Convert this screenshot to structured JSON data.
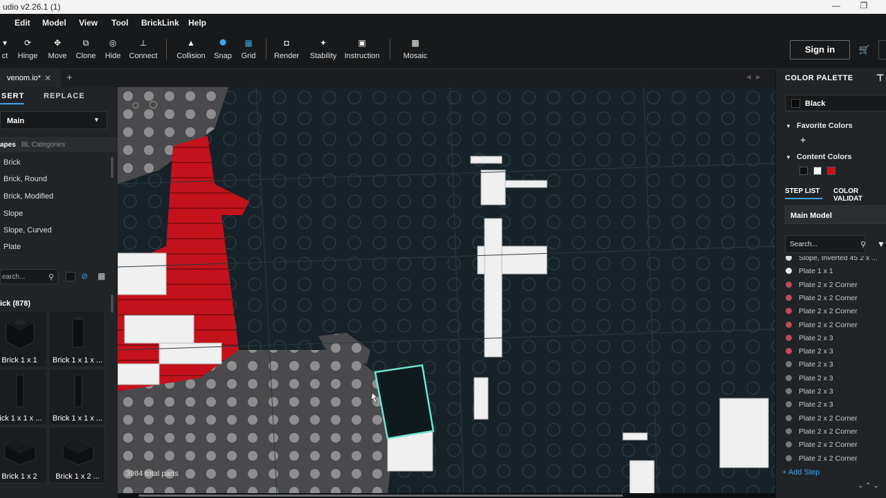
{
  "window": {
    "title": "udio v2.26.1 (1)",
    "minimize": "—",
    "restore": "❐"
  },
  "menu": [
    "Edit",
    "Model",
    "View",
    "Tool",
    "BrickLink",
    "Help"
  ],
  "toolbar": {
    "tools": [
      {
        "label": "ct",
        "icon": "▾"
      },
      {
        "label": "Hinge",
        "icon": "⟳"
      },
      {
        "label": "Move",
        "icon": "✥"
      },
      {
        "label": "Clone",
        "icon": "⧉"
      },
      {
        "label": "Hide",
        "icon": "◎"
      },
      {
        "label": "Connect",
        "icon": "⊥"
      },
      {
        "label": "Collision",
        "icon": "▲"
      },
      {
        "label": "Snap",
        "icon": "⯃"
      },
      {
        "label": "Grid",
        "icon": "▦"
      },
      {
        "label": "Render",
        "icon": "◘"
      },
      {
        "label": "Stability",
        "icon": "✦"
      },
      {
        "label": "Instruction",
        "icon": "▣"
      },
      {
        "label": "Mosaic",
        "icon": "▩"
      }
    ],
    "signin": "Sign in",
    "cart_icon": "🛒"
  },
  "tabs": {
    "doc": "venom.io*",
    "close": "✕",
    "new": "+"
  },
  "left": {
    "tab_insert": "SERT",
    "tab_replace": "REPLACE",
    "library": "Main",
    "cat_tabs": [
      "apes",
      "BL Categories"
    ],
    "categories": [
      "Brick",
      "Brick, Round",
      "Brick, Modified",
      "Slope",
      "Slope, Curved",
      "Plate"
    ],
    "search_placeholder": "earch...",
    "group_title": "ick (878)",
    "parts": [
      "Brick 1 x 1",
      "Brick 1 x 1 x ...",
      "rick 1 x 1 x ...",
      "Brick 1 x 1 x ...",
      "Brick 1 x 2",
      "Brick 1 x 2 ..."
    ]
  },
  "viewport": {
    "total_parts": "3984 total parts"
  },
  "right": {
    "palette_title": "COLOR PALETTE",
    "selected_color": "Black",
    "favorite_title": "Favorite Colors",
    "favorite_add": "+",
    "content_title": "Content Colors",
    "content_colors": [
      "#0e0f10",
      "#ffffff",
      "#c8101c"
    ],
    "step_tab": "STEP LIST",
    "color_tab": "COLOR VALIDAT",
    "model": "Main Model",
    "search_placeholder": "Search...",
    "steps": [
      {
        "label": "Slope, Inverted 45 2 x ...",
        "color": "#e0e0e0"
      },
      {
        "label": "Plate 1 x 1",
        "color": "#e8e8e8"
      },
      {
        "label": "Plate 2 x 2 Corner",
        "color": "#c04a5a"
      },
      {
        "label": "Plate 2 x 2 Corner",
        "color": "#c04a5a"
      },
      {
        "label": "Plate 2 x 2 Corner",
        "color": "#c04a5a"
      },
      {
        "label": "Plate 2 x 2 Corner",
        "color": "#c04a5a"
      },
      {
        "label": "Plate 2 x 3",
        "color": "#c04a5a"
      },
      {
        "label": "Plate 2 x 3",
        "color": "#c04a5a"
      },
      {
        "label": "Plate 2 x 3",
        "color": "#777777"
      },
      {
        "label": "Plate 2 x 3",
        "color": "#777777"
      },
      {
        "label": "Plate 2 x 3",
        "color": "#777777"
      },
      {
        "label": "Plate 2 x 3",
        "color": "#777777"
      },
      {
        "label": "Plate 2 x 2 Corner",
        "color": "#777777"
      },
      {
        "label": "Plate 2 x 2 Corner",
        "color": "#777777"
      },
      {
        "label": "Plate 2 x 2 Corner",
        "color": "#777777"
      },
      {
        "label": "Plate 2 x 2 Corner",
        "color": "#777777"
      }
    ],
    "add_step": "+ Add Step",
    "bottom_icons": "⌄ ⌃ ⌄"
  }
}
